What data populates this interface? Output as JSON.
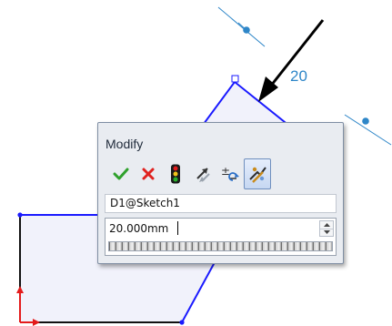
{
  "sketch": {
    "dimension_value_label": "20",
    "colors": {
      "selected_edge": "#1a1aff",
      "sketch_line": "#111111",
      "fill": "#f1f2fb",
      "dimension": "#2e86c8",
      "origin": "#e41b1b"
    }
  },
  "modify_dialog": {
    "title": "Modify",
    "toolbar": [
      {
        "name": "ok-checkmark-icon",
        "tooltip": "OK"
      },
      {
        "name": "cancel-x-icon",
        "tooltip": "Cancel"
      },
      {
        "name": "rebuild-traffic-light-icon",
        "tooltip": "Rebuild"
      },
      {
        "name": "reverse-dimension-icon",
        "tooltip": "Reverse the sense of the dimension"
      },
      {
        "name": "increment-spin-icon",
        "tooltip": "Reset spin increment value"
      },
      {
        "name": "mark-dimension-icon",
        "tooltip": "Mark dimension for drawing",
        "selected": true
      }
    ],
    "dimension_name": "D1@Sketch1",
    "value": "20.000mm"
  }
}
